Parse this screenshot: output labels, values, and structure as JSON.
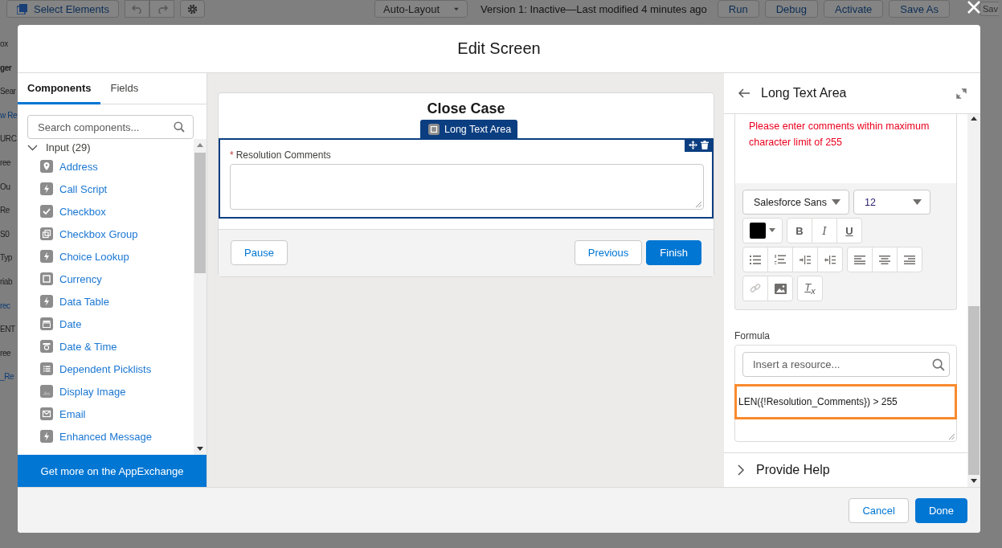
{
  "background": {
    "toolbar": {
      "select_elements": "Select Elements",
      "layout": "Auto-Layout",
      "version_status": "Version 1: Inactive—Last modified 4 minutes ago",
      "buttons": [
        "Run",
        "Debug",
        "Activate",
        "Save As"
      ],
      "cut_button": "Sav"
    },
    "side_fragments": [
      {
        "text": "ox",
        "kind": "plain"
      },
      {
        "text": "ger",
        "kind": "bold"
      },
      {
        "text": "Sear",
        "kind": "plain"
      },
      {
        "text": "w Re",
        "kind": "link"
      },
      {
        "text": "URC",
        "kind": "plain"
      },
      {
        "text": "ree",
        "kind": "plain"
      },
      {
        "text": "Ou",
        "kind": "plain"
      },
      {
        "text": "Re",
        "kind": "plain"
      },
      {
        "text": "S0",
        "kind": "plain"
      },
      {
        "text": "Typ",
        "kind": "plain"
      },
      {
        "text": "riab",
        "kind": "plain"
      },
      {
        "text": "rec",
        "kind": "link"
      },
      {
        "text": "ENT",
        "kind": "plain"
      },
      {
        "text": "ree",
        "kind": "plain"
      },
      {
        "text": "_Re",
        "kind": "link"
      }
    ]
  },
  "modal": {
    "title": "Edit Screen",
    "left_panel": {
      "tabs": [
        {
          "label": "Components",
          "selected": true
        },
        {
          "label": "Fields",
          "selected": false
        }
      ],
      "search": {
        "placeholder": "Search components..."
      },
      "section": {
        "label": "Input (29)",
        "expanded": true,
        "items": [
          {
            "label": "Address",
            "kind": "location"
          },
          {
            "label": "Call Script",
            "kind": "bolt"
          },
          {
            "label": "Checkbox",
            "kind": "check"
          },
          {
            "label": "Checkbox Group",
            "kind": "checkgroup"
          },
          {
            "label": "Choice Lookup",
            "kind": "bolt"
          },
          {
            "label": "Currency",
            "kind": "field"
          },
          {
            "label": "Data Table",
            "kind": "bolt"
          },
          {
            "label": "Date",
            "kind": "calendar"
          },
          {
            "label": "Date & Time",
            "kind": "datetime"
          },
          {
            "label": "Dependent Picklists",
            "kind": "list"
          },
          {
            "label": "Display Image",
            "kind": "image"
          },
          {
            "label": "Email",
            "kind": "mail"
          },
          {
            "label": "Enhanced Message",
            "kind": "bolt"
          }
        ]
      },
      "appexchange": "Get more on the AppExchange"
    },
    "canvas": {
      "screen_title": "Close Case",
      "component_tag": "Long Text Area",
      "field": {
        "required_mark": "*",
        "label": "Resolution Comments"
      },
      "buttons": [
        {
          "label": "Pause",
          "kind": "neutral"
        },
        {
          "label": "Previous",
          "kind": "neutral"
        },
        {
          "label": "Finish",
          "kind": "brand"
        }
      ]
    },
    "properties": {
      "title": "Long Text Area",
      "error_message": "Please enter comments within maximum character limit of 255",
      "font_family": "Salesforce Sans",
      "font_size": "12",
      "format_buttons": [
        "B",
        "I",
        "U"
      ],
      "clear_format": "T$_{x}$",
      "formula_label": "Formula",
      "resource_search": {
        "placeholder": "Insert a resource..."
      },
      "formula": "LEN({!Resolution_Comments}) > 255",
      "provide_help": {
        "label": "Provide Help",
        "expanded": false
      }
    },
    "footer": {
      "cancel": "Cancel",
      "done": "Done"
    }
  }
}
